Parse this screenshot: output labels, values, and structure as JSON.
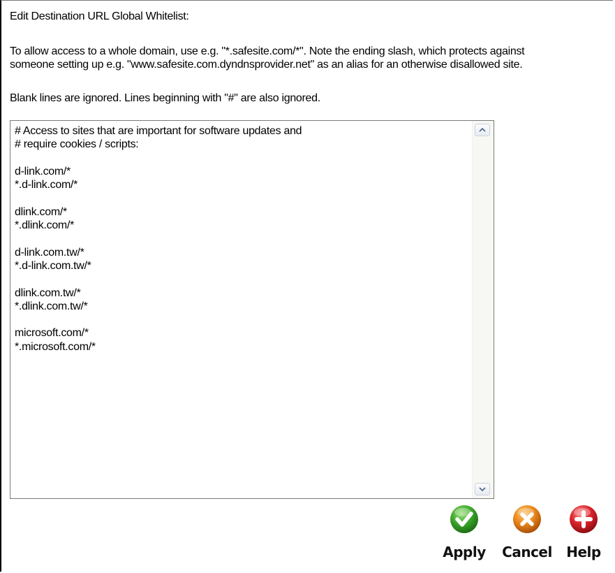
{
  "form": {
    "title": "Edit Destination URL Global Whitelist:",
    "instruction_line1": "To allow access to a whole domain, use e.g. \"*.safesite.com/*\". Note the ending slash, which protects against",
    "instruction_line2": "someone setting up e.g. \"www.safesite.com.dyndnsprovider.net\" as an alias for an otherwise disallowed site.",
    "note": "Blank lines are ignored. Lines beginning with \"#\" are also ignored."
  },
  "whitelist": {
    "value": "# Access to sites that are important for software updates and\n# require cookies / scripts:\n\nd-link.com/*\n*.d-link.com/*\n\ndlink.com/*\n*.dlink.com/*\n\nd-link.com.tw/*\n*.d-link.com.tw/*\n\ndlink.com.tw/*\n*.dlink.com.tw/*\n\nmicrosoft.com/*\n*.microsoft.com/*"
  },
  "actions": {
    "apply": {
      "label": "Apply",
      "icon": "check-icon",
      "color": "#3aa52a"
    },
    "cancel": {
      "label": "Cancel",
      "icon": "close-icon",
      "color": "#e8861a"
    },
    "help": {
      "label": "Help",
      "icon": "plus-icon",
      "color": "#d8232a"
    }
  }
}
